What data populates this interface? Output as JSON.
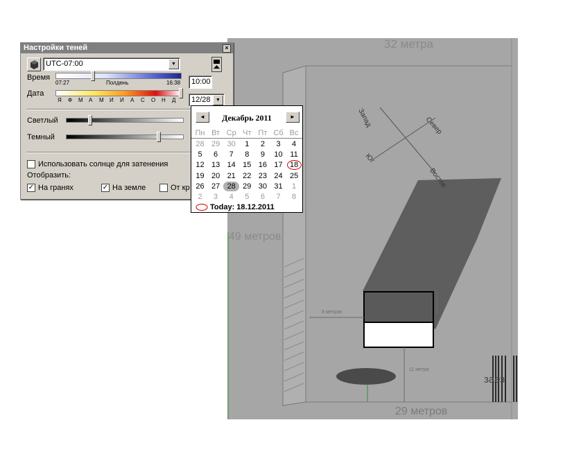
{
  "dialog": {
    "title": "Настройки теней",
    "close_glyph": "×",
    "timezone": "UTC-07:00",
    "time_label": "Время",
    "time_min": "07:27",
    "time_mid": "Полдень",
    "time_max": "16:38",
    "time_value": "10:00",
    "date_label": "Дата",
    "months": [
      "Я",
      "Ф",
      "М",
      "А",
      "М",
      "И",
      "И",
      "А",
      "С",
      "О",
      "Н",
      "Д"
    ],
    "date_value": "12/28",
    "light_label": "Светлый",
    "dark_label": "Темный",
    "use_sun_label": "Использовать солнце для затенения",
    "display_label": "Отобразить:",
    "on_faces_label": "На гранях",
    "on_ground_label": "На земле",
    "from_edges_label": "От кр",
    "use_sun_checked": false,
    "on_faces_checked": true,
    "on_ground_checked": true,
    "from_edges_checked": false
  },
  "calendar": {
    "title": "Декабрь 2011",
    "weekdays": [
      "Пн",
      "Вт",
      "Ср",
      "Чт",
      "Пт",
      "Сб",
      "Вс"
    ],
    "weeks": [
      [
        "28",
        "29",
        "30",
        "1",
        "2",
        "3",
        "4"
      ],
      [
        "5",
        "6",
        "7",
        "8",
        "9",
        "10",
        "11"
      ],
      [
        "12",
        "13",
        "14",
        "15",
        "16",
        "17",
        "18"
      ],
      [
        "19",
        "20",
        "21",
        "22",
        "23",
        "24",
        "25"
      ],
      [
        "26",
        "27",
        "28",
        "29",
        "30",
        "31",
        "1"
      ],
      [
        "2",
        "3",
        "4",
        "5",
        "6",
        "7",
        "8"
      ]
    ],
    "today_label": "Today: 18.12.2011",
    "prev_glyph": "◄",
    "next_glyph": "►"
  },
  "scene": {
    "top_dim": "32 метра",
    "left_dim": "49 метров",
    "bottom_dim": "29 метров",
    "dim_8": "8 метров",
    "dim_11": "11 метра",
    "west": "Запад",
    "north": "Север",
    "south": "Юг",
    "east": "Восток",
    "partial_label": "заез"
  }
}
